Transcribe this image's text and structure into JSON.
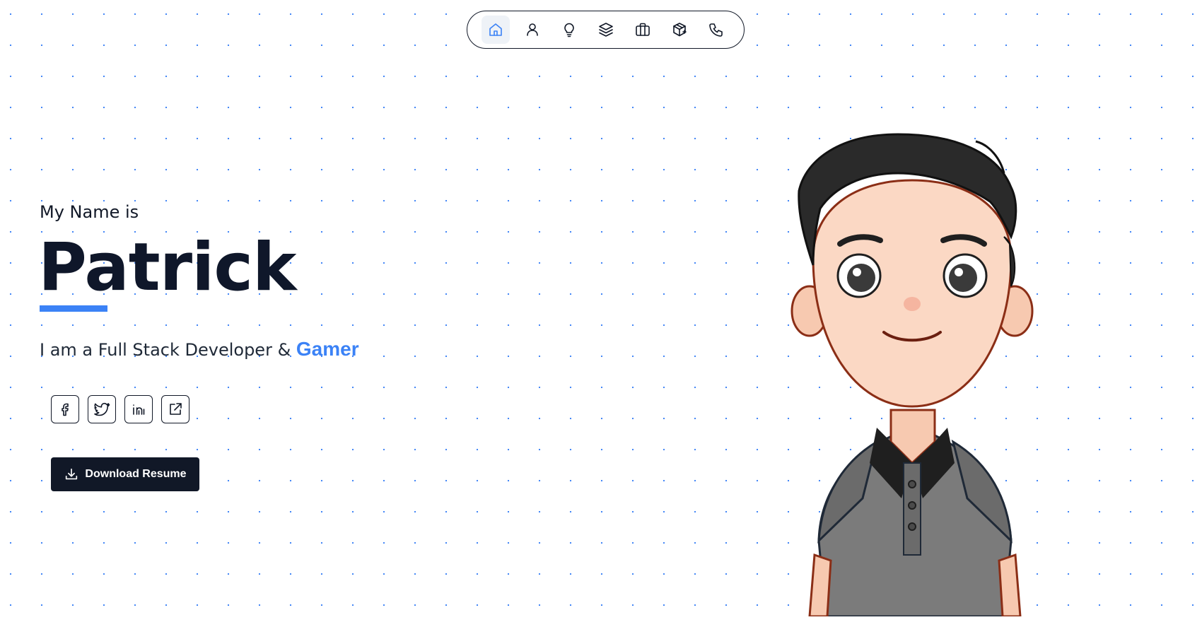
{
  "nav": {
    "items": [
      {
        "icon": "home-icon",
        "active": true
      },
      {
        "icon": "user-icon",
        "active": false
      },
      {
        "icon": "lightbulb-icon",
        "active": false
      },
      {
        "icon": "layers-icon",
        "active": false
      },
      {
        "icon": "briefcase-icon",
        "active": false
      },
      {
        "icon": "package-icon",
        "active": false
      },
      {
        "icon": "phone-icon",
        "active": false
      }
    ]
  },
  "hero": {
    "intro": "My Name is",
    "name": "Patrick",
    "tagline_prefix": "I am a Full Stack Developer & ",
    "tagline_highlight": "Gamer"
  },
  "socials": [
    {
      "icon": "facebook-icon"
    },
    {
      "icon": "twitter-icon"
    },
    {
      "icon": "linkedin-icon"
    },
    {
      "icon": "external-link-icon"
    }
  ],
  "actions": {
    "download_label": "Download Resume",
    "download_icon": "download-icon"
  },
  "colors": {
    "accent": "#3b82f6",
    "dark": "#111827",
    "background": "#ffffff"
  },
  "avatar": {
    "description_icon": "cartoon-avatar"
  }
}
